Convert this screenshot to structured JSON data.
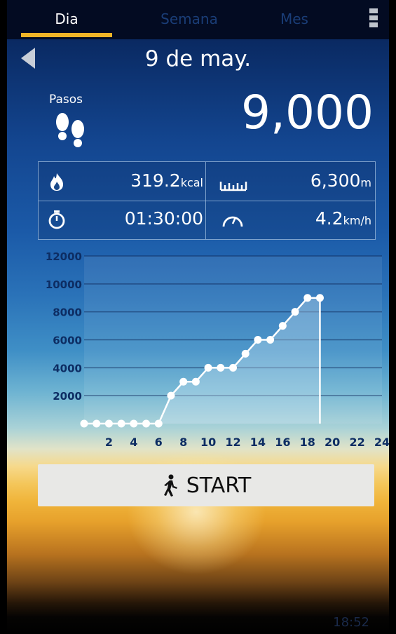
{
  "tabs": [
    {
      "label": "Dia",
      "active": true
    },
    {
      "label": "Semana",
      "active": false
    },
    {
      "label": "Mes",
      "active": false
    }
  ],
  "header": {
    "date": "9 de may."
  },
  "steps": {
    "label": "Pasos",
    "count": "9,000"
  },
  "stats": {
    "calories": {
      "value": "319.2",
      "unit": "kcal",
      "icon": "flame-icon"
    },
    "distance": {
      "value": "6,300",
      "unit": "m",
      "icon": "ruler-icon"
    },
    "duration": {
      "value": "01:30:00",
      "icon": "stopwatch-icon"
    },
    "speed": {
      "value": "4.2",
      "unit": "km/h",
      "icon": "speedometer-icon"
    }
  },
  "chart_data": {
    "type": "area",
    "x": [
      0,
      1,
      2,
      3,
      4,
      5,
      6,
      7,
      8,
      9,
      10,
      11,
      12,
      13,
      14,
      15,
      16,
      17,
      18,
      19
    ],
    "y": [
      0,
      0,
      0,
      0,
      0,
      0,
      0,
      2000,
      3000,
      3000,
      4000,
      4000,
      4000,
      5000,
      6000,
      6000,
      7000,
      8000,
      9000,
      9000
    ],
    "xticks": [
      2,
      4,
      6,
      8,
      10,
      12,
      14,
      16,
      18,
      20,
      22,
      24
    ],
    "yticks": [
      2000,
      4000,
      6000,
      8000,
      10000,
      12000
    ],
    "xlim": [
      0,
      24
    ],
    "ylim": [
      0,
      12000
    ],
    "grid": true
  },
  "start_button": {
    "label": "START",
    "icon": "walking-person-icon"
  },
  "status_bar": {
    "time": "18:52"
  }
}
